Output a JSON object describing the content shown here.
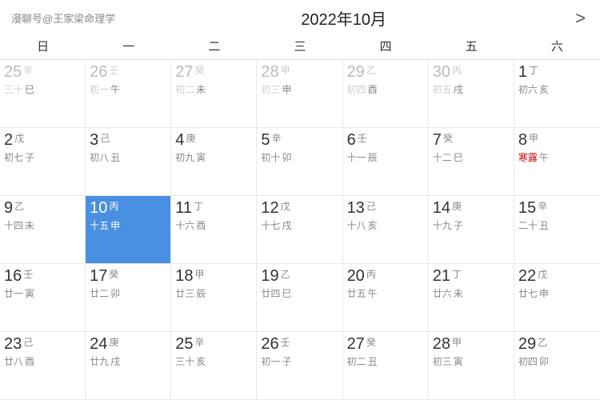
{
  "header": {
    "logo": "漫聊号@王家梁命理学",
    "title": "2022年10月",
    "nav_next": ">"
  },
  "weekdays": [
    "日",
    "一",
    "二",
    "三",
    "四",
    "五",
    "六"
  ],
  "weeks": [
    [
      {
        "num": "25",
        "gz1": "辛",
        "lunar": "三十",
        "gz2": "巳",
        "other": true
      },
      {
        "num": "26",
        "gz1": "壬",
        "lunar": "初一",
        "gz2": "午",
        "other": true
      },
      {
        "num": "27",
        "gz1": "癸",
        "lunar": "初二",
        "gz2": "未",
        "other": true
      },
      {
        "num": "28",
        "gz1": "甲",
        "lunar": "初三",
        "gz2": "申",
        "other": true
      },
      {
        "num": "29",
        "gz1": "乙",
        "lunar": "初四",
        "gz2": "酉",
        "other": true
      },
      {
        "num": "30",
        "gz1": "丙",
        "lunar": "初五",
        "gz2": "戌",
        "other": true
      },
      {
        "num": "1",
        "gz1": "丁",
        "lunar": "初六",
        "gz2": "亥",
        "other": false
      }
    ],
    [
      {
        "num": "2",
        "gz1": "戊",
        "lunar": "初七",
        "gz2": "子",
        "other": false
      },
      {
        "num": "3",
        "gz1": "己",
        "lunar": "初八",
        "gz2": "丑",
        "other": false
      },
      {
        "num": "4",
        "gz1": "庚",
        "lunar": "初九",
        "gz2": "寅",
        "other": false
      },
      {
        "num": "5",
        "gz1": "辛",
        "lunar": "初十",
        "gz2": "卯",
        "other": false
      },
      {
        "num": "6",
        "gz1": "壬",
        "lunar": "十一",
        "gz2": "辰",
        "other": false
      },
      {
        "num": "7",
        "gz1": "癸",
        "lunar": "十二",
        "gz2": "巳",
        "other": false
      },
      {
        "num": "8",
        "gz1": "甲",
        "lunar": "寒露",
        "gz2": "午",
        "other": false,
        "solar_term": true
      }
    ],
    [
      {
        "num": "9",
        "gz1": "乙",
        "lunar": "十四",
        "gz2": "未",
        "other": false
      },
      {
        "num": "10",
        "gz1": "丙",
        "lunar": "十五",
        "gz2": "申",
        "other": false,
        "selected": true
      },
      {
        "num": "11",
        "gz1": "丁",
        "lunar": "十六",
        "gz2": "酉",
        "other": false
      },
      {
        "num": "12",
        "gz1": "戊",
        "lunar": "十七",
        "gz2": "戌",
        "other": false
      },
      {
        "num": "13",
        "gz1": "己",
        "lunar": "十八",
        "gz2": "亥",
        "other": false
      },
      {
        "num": "14",
        "gz1": "庚",
        "lunar": "十九",
        "gz2": "子",
        "other": false
      },
      {
        "num": "15",
        "gz1": "辛",
        "lunar": "二十",
        "gz2": "丑",
        "other": false
      }
    ],
    [
      {
        "num": "16",
        "gz1": "壬",
        "lunar": "廿一",
        "gz2": "寅",
        "other": false
      },
      {
        "num": "17",
        "gz1": "癸",
        "lunar": "廿二",
        "gz2": "卯",
        "other": false
      },
      {
        "num": "18",
        "gz1": "甲",
        "lunar": "廿三",
        "gz2": "辰",
        "other": false
      },
      {
        "num": "19",
        "gz1": "乙",
        "lunar": "廿四",
        "gz2": "巳",
        "other": false
      },
      {
        "num": "20",
        "gz1": "丙",
        "lunar": "廿五",
        "gz2": "午",
        "other": false
      },
      {
        "num": "21",
        "gz1": "丁",
        "lunar": "廿六",
        "gz2": "未",
        "other": false
      },
      {
        "num": "22",
        "gz1": "戊",
        "lunar": "廿七",
        "gz2": "申",
        "other": false
      }
    ],
    [
      {
        "num": "23",
        "gz1": "己",
        "lunar": "廿八",
        "gz2": "酉",
        "other": false
      },
      {
        "num": "24",
        "gz1": "庚",
        "lunar": "廿九",
        "gz2": "戌",
        "other": false
      },
      {
        "num": "25",
        "gz1": "辛",
        "lunar": "三十",
        "gz2": "亥",
        "other": false
      },
      {
        "num": "26",
        "gz1": "壬",
        "lunar": "初一",
        "gz2": "子",
        "other": false
      },
      {
        "num": "27",
        "gz1": "癸",
        "lunar": "初二",
        "gz2": "丑",
        "other": false
      },
      {
        "num": "28",
        "gz1": "甲",
        "lunar": "初三",
        "gz2": "寅",
        "other": false
      },
      {
        "num": "29",
        "gz1": "乙",
        "lunar": "初四",
        "gz2": "卯",
        "other": false
      }
    ]
  ]
}
